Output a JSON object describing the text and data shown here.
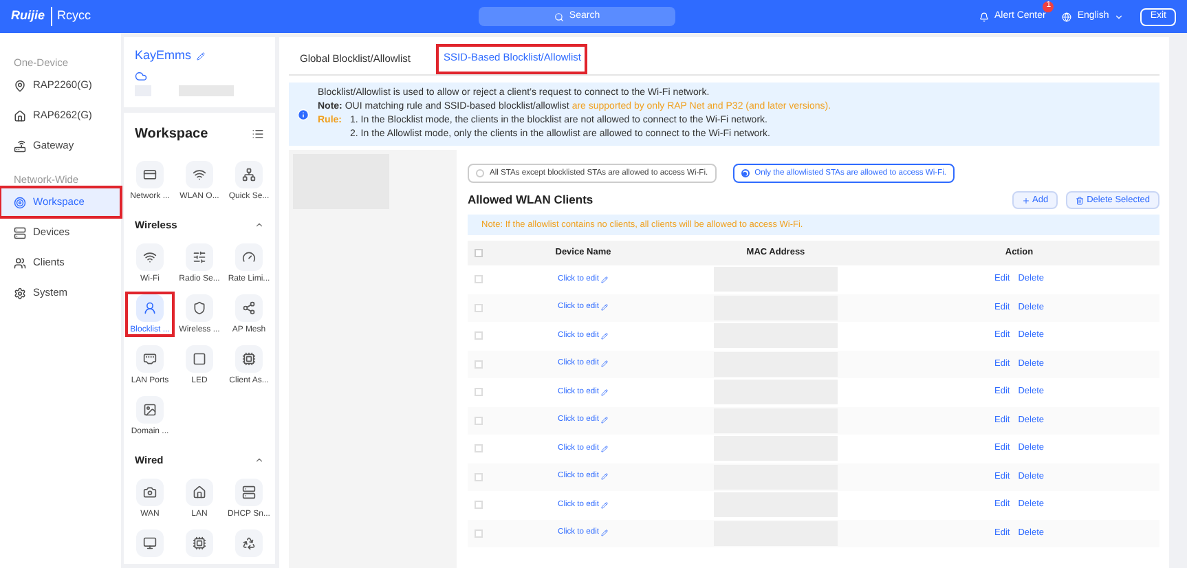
{
  "header": {
    "logo": "Ruijie",
    "brand": "Rcycc",
    "search": "Search",
    "alert": {
      "label": "Alert Center",
      "badge": "1"
    },
    "language": "English",
    "exit": "Exit"
  },
  "nav": [
    {
      "kind": "group",
      "label": "One-Device"
    },
    {
      "kind": "item",
      "label": "RAP2260(G)",
      "selected": false,
      "highlighted": false
    },
    {
      "kind": "item",
      "label": "RAP6262(G)",
      "selected": false,
      "highlighted": false
    },
    {
      "kind": "item",
      "label": "Gateway",
      "selected": false,
      "highlighted": false
    },
    {
      "kind": "group",
      "label": "Network-Wide"
    },
    {
      "kind": "item",
      "label": "Workspace",
      "selected": true,
      "highlighted": true
    },
    {
      "kind": "item",
      "label": "Devices",
      "selected": false,
      "highlighted": false
    },
    {
      "kind": "item",
      "label": "Clients",
      "selected": false,
      "highlighted": false
    },
    {
      "kind": "item",
      "label": "System",
      "selected": false,
      "highlighted": false
    }
  ],
  "workspace_panel": {
    "network_name": "KayEmms",
    "title": "Workspace",
    "top_tiles": [
      {
        "label": "Network ...",
        "selected": false,
        "highlighted": false
      },
      {
        "label": "WLAN O...",
        "selected": false,
        "highlighted": false
      },
      {
        "label": "Quick Se...",
        "selected": false,
        "highlighted": false
      }
    ],
    "sections": [
      {
        "title": "Wireless",
        "expanded": true,
        "tiles": [
          {
            "label": "Wi-Fi",
            "selected": false,
            "highlighted": false
          },
          {
            "label": "Radio Se...",
            "selected": false,
            "highlighted": false
          },
          {
            "label": "Rate Limi...",
            "selected": false,
            "highlighted": false
          },
          {
            "label": "Blocklist ...",
            "selected": true,
            "highlighted": true
          },
          {
            "label": "Wireless ...",
            "selected": false,
            "highlighted": false
          },
          {
            "label": "AP Mesh",
            "selected": false,
            "highlighted": false
          },
          {
            "label": "LAN Ports",
            "selected": false,
            "highlighted": false
          },
          {
            "label": "LED",
            "selected": false,
            "highlighted": false
          },
          {
            "label": "Client As...",
            "selected": false,
            "highlighted": false
          },
          {
            "label": "Domain ...",
            "selected": false,
            "highlighted": false
          }
        ]
      },
      {
        "title": "Wired",
        "expanded": true,
        "tiles": [
          {
            "label": "WAN",
            "selected": false,
            "highlighted": false
          },
          {
            "label": "LAN",
            "selected": false,
            "highlighted": false
          },
          {
            "label": "DHCP Sn...",
            "selected": false,
            "highlighted": false
          },
          {
            "selected": false,
            "highlighted": false
          },
          {
            "selected": false,
            "highlighted": false
          },
          {
            "selected": false,
            "highlighted": false
          }
        ]
      }
    ]
  },
  "tabs": [
    {
      "label": "Global Blocklist/Allowlist",
      "selected": false,
      "highlighted": false
    },
    {
      "label": "SSID-Based Blocklist/Allowlist",
      "selected": true,
      "highlighted": true
    }
  ],
  "info": {
    "line_1": "Blocklist/Allowlist is used to allow or reject a client’s request to connect to the Wi-Fi network.",
    "note_label": "Note:",
    "note_text": "OUI matching rule and SSID-based blocklist/allowlist",
    "note_warning": "are supported by only RAP Net and P32 (and later versions).",
    "rule_label": "Rule:",
    "rules": [
      "1. In the Blocklist mode, the clients in the blocklist are not allowed to connect to the Wi-Fi network.",
      "2. In the Allowlist mode, only the clients in the allowlist are allowed to connect to the Wi-Fi network."
    ]
  },
  "modes": [
    {
      "label": "All STAs except blocklisted STAs are allowed to access Wi-Fi.",
      "selected": false
    },
    {
      "label": "Only the allowlisted STAs are allowed to access Wi-Fi.",
      "selected": true
    }
  ],
  "list": {
    "title": "Allowed WLAN Clients",
    "add": "Add",
    "delete_selected": "Delete Selected",
    "note": "Note: If the allowlist contains no clients, all clients will be allowed to access Wi-Fi.",
    "all_checked": false,
    "columns": [
      "Device Name",
      "MAC Address",
      "Action"
    ],
    "rows": [
      {
        "device": "Click to edit",
        "checked": false,
        "edit": "Edit",
        "delete": "Delete"
      },
      {
        "device": "Click to edit",
        "checked": false,
        "edit": "Edit",
        "delete": "Delete"
      },
      {
        "device": "Click to edit",
        "checked": false,
        "edit": "Edit",
        "delete": "Delete"
      },
      {
        "device": "Click to edit",
        "checked": false,
        "edit": "Edit",
        "delete": "Delete"
      },
      {
        "device": "Click to edit",
        "checked": false,
        "edit": "Edit",
        "delete": "Delete"
      },
      {
        "device": "Click to edit",
        "checked": false,
        "edit": "Edit",
        "delete": "Delete"
      },
      {
        "device": "Click to edit",
        "checked": false,
        "edit": "Edit",
        "delete": "Delete"
      },
      {
        "device": "Click to edit",
        "checked": false,
        "edit": "Edit",
        "delete": "Delete"
      },
      {
        "device": "Click to edit",
        "checked": false,
        "edit": "Edit",
        "delete": "Delete"
      },
      {
        "device": "Click to edit",
        "checked": false,
        "edit": "Edit",
        "delete": "Delete"
      }
    ]
  }
}
